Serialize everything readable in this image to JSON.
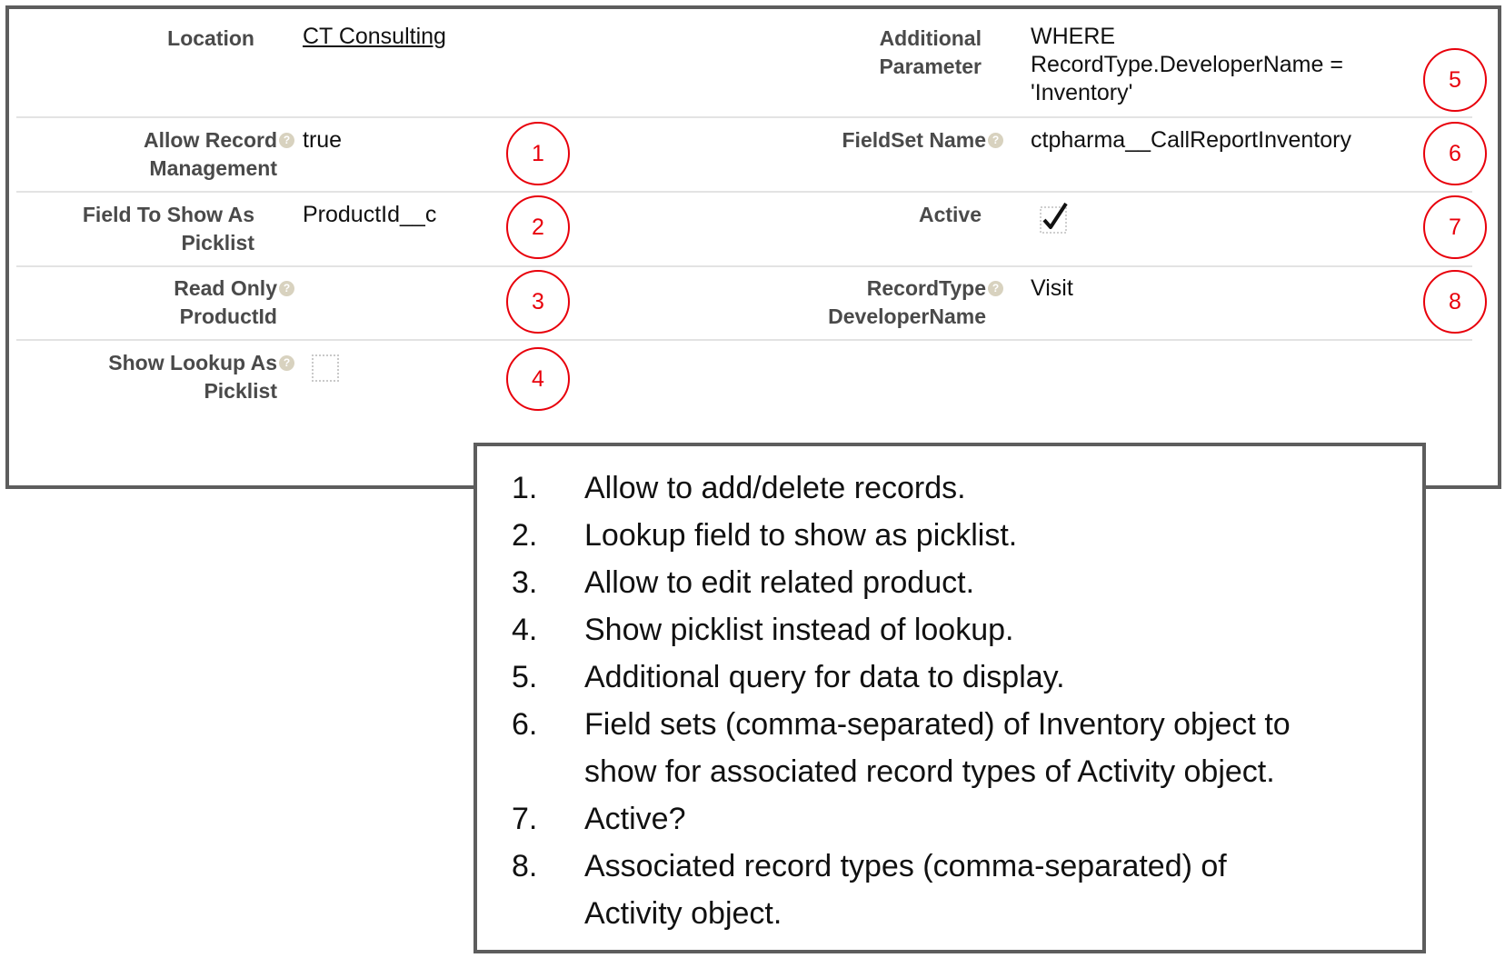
{
  "fields": {
    "location": {
      "label": "Location",
      "value": "CT Consulting"
    },
    "allow_record": {
      "label_1": "Allow Record",
      "label_2": "Management",
      "value": "true"
    },
    "field_to_show": {
      "label_1": "Field To Show As",
      "label_2": "Picklist",
      "value": "ProductId__c"
    },
    "read_only": {
      "label_1": "Read Only",
      "label_2": "ProductId",
      "value": ""
    },
    "show_lookup": {
      "label_1": "Show Lookup As",
      "label_2": "Picklist",
      "checked": false
    },
    "additional_param": {
      "label_1": "Additional",
      "label_2": "Parameter",
      "value_1": "WHERE",
      "value_2": "RecordType.DeveloperName =",
      "value_3": "'Inventory'"
    },
    "fieldset": {
      "label": "FieldSet Name",
      "value": "ctpharma__CallReportInventory"
    },
    "active": {
      "label": "Active",
      "checked": true
    },
    "record_type": {
      "label_1": "RecordType",
      "label_2": "DeveloperName",
      "value": "Visit"
    }
  },
  "help_icon_glyph": "?",
  "markers": [
    "1",
    "2",
    "3",
    "4",
    "5",
    "6",
    "7",
    "8"
  ],
  "notes": [
    {
      "n": "1.",
      "lines": [
        "Allow to add/delete records."
      ]
    },
    {
      "n": "2.",
      "lines": [
        "Lookup field to show as picklist."
      ]
    },
    {
      "n": "3.",
      "lines": [
        "Allow to edit related product."
      ]
    },
    {
      "n": "4.",
      "lines": [
        "Show picklist instead of lookup."
      ]
    },
    {
      "n": "5.",
      "lines": [
        "Additional query for data to display."
      ]
    },
    {
      "n": "6.",
      "lines": [
        "Field sets (comma-separated) of Inventory object to",
        "show for associated record types of Activity object."
      ]
    },
    {
      "n": "7.",
      "lines": [
        "Active?"
      ]
    },
    {
      "n": "8.",
      "lines": [
        "Associated record types (comma-separated) of",
        "Activity object."
      ]
    }
  ],
  "colors": {
    "marker": "#e8000b",
    "border": "#5d5d5d",
    "label": "#4a4a4a",
    "help": "#d8d2bf"
  }
}
